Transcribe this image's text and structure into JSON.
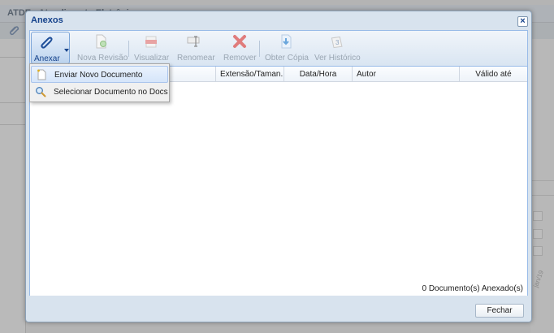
{
  "background": {
    "app_title": "ATDE - Atendimento Eletrônico",
    "date_fragment": "jan/19"
  },
  "dialog": {
    "title": "Anexos",
    "close_glyph": "×",
    "toolbar": {
      "buttons": [
        {
          "label": "Anexar",
          "icon": "paperclip-icon",
          "enabled": true
        },
        {
          "label": "Nova Revisão",
          "icon": "new-revision-icon",
          "enabled": false
        },
        {
          "label": "Visualizar",
          "icon": "view-icon",
          "enabled": false
        },
        {
          "label": "Renomear",
          "icon": "rename-icon",
          "enabled": false
        },
        {
          "label": "Remover",
          "icon": "remove-icon",
          "enabled": false
        },
        {
          "label": "Obter Cópia",
          "icon": "download-copy-icon",
          "enabled": false
        },
        {
          "label": "Ver Histórico",
          "icon": "history-icon",
          "enabled": false
        }
      ]
    },
    "grid": {
      "columns": [
        "",
        "Extensão/Taman...",
        "Data/Hora",
        "Autor",
        "Válido até"
      ],
      "rows": []
    },
    "status": "0 Documento(s) Anexado(s)",
    "close_button": "Fechar"
  },
  "menu": {
    "items": [
      {
        "label": "Enviar Novo Documento",
        "icon": "new-document-icon"
      },
      {
        "label": "Selecionar Documento no Docs",
        "icon": "magnifier-icon"
      }
    ]
  },
  "colors": {
    "dialog_title": "#15428b",
    "accent_underline": "#cc0000",
    "panel_border": "#99bbe8"
  }
}
